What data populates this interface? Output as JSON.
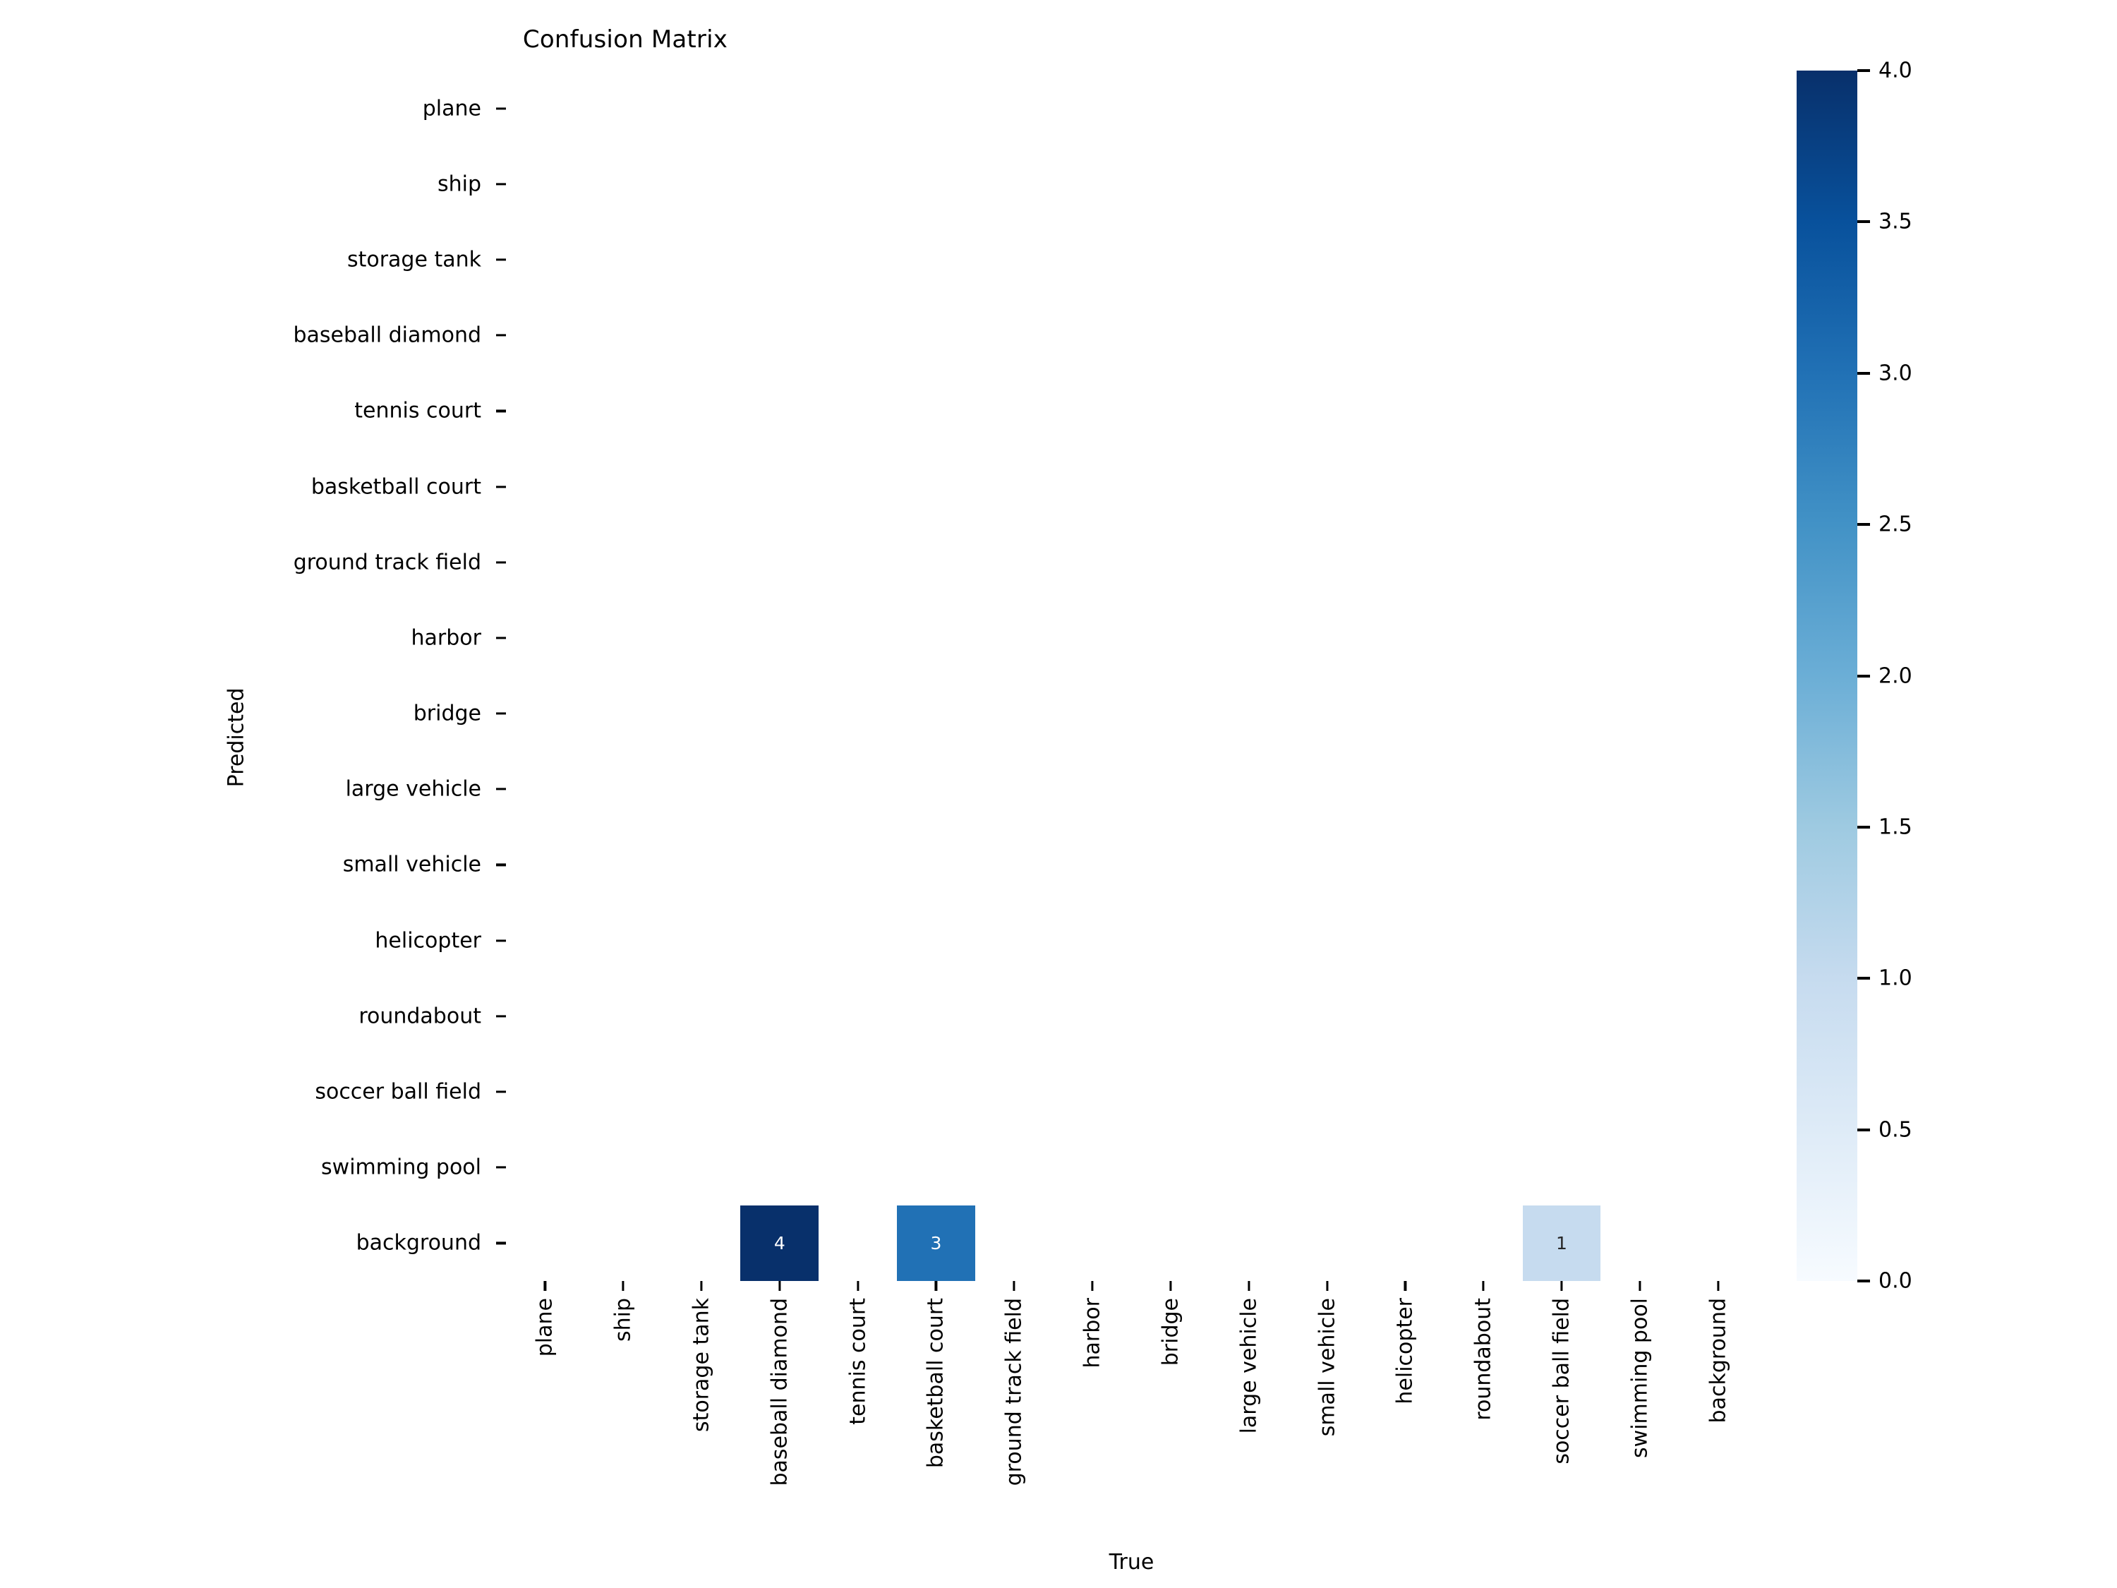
{
  "chart_data": {
    "type": "heatmap",
    "title": "Confusion Matrix",
    "xlabel": "True",
    "ylabel": "Predicted",
    "x_categories": [
      "plane",
      "ship",
      "storage tank",
      "baseball diamond",
      "tennis court",
      "basketball court",
      "ground track field",
      "harbor",
      "bridge",
      "large vehicle",
      "small vehicle",
      "helicopter",
      "roundabout",
      "soccer ball field",
      "swimming pool",
      "background"
    ],
    "y_categories": [
      "plane",
      "ship",
      "storage tank",
      "baseball diamond",
      "tennis court",
      "basketball court",
      "ground track field",
      "harbor",
      "bridge",
      "large vehicle",
      "small vehicle",
      "helicopter",
      "roundabout",
      "soccer ball field",
      "swimming pool",
      "background"
    ],
    "values": [
      [
        0,
        0,
        0,
        0,
        0,
        0,
        0,
        0,
        0,
        0,
        0,
        0,
        0,
        0,
        0,
        0
      ],
      [
        0,
        0,
        0,
        0,
        0,
        0,
        0,
        0,
        0,
        0,
        0,
        0,
        0,
        0,
        0,
        0
      ],
      [
        0,
        0,
        0,
        0,
        0,
        0,
        0,
        0,
        0,
        0,
        0,
        0,
        0,
        0,
        0,
        0
      ],
      [
        0,
        0,
        0,
        0,
        0,
        0,
        0,
        0,
        0,
        0,
        0,
        0,
        0,
        0,
        0,
        0
      ],
      [
        0,
        0,
        0,
        0,
        0,
        0,
        0,
        0,
        0,
        0,
        0,
        0,
        0,
        0,
        0,
        0
      ],
      [
        0,
        0,
        0,
        0,
        0,
        0,
        0,
        0,
        0,
        0,
        0,
        0,
        0,
        0,
        0,
        0
      ],
      [
        0,
        0,
        0,
        0,
        0,
        0,
        0,
        0,
        0,
        0,
        0,
        0,
        0,
        0,
        0,
        0
      ],
      [
        0,
        0,
        0,
        0,
        0,
        0,
        0,
        0,
        0,
        0,
        0,
        0,
        0,
        0,
        0,
        0
      ],
      [
        0,
        0,
        0,
        0,
        0,
        0,
        0,
        0,
        0,
        0,
        0,
        0,
        0,
        0,
        0,
        0
      ],
      [
        0,
        0,
        0,
        0,
        0,
        0,
        0,
        0,
        0,
        0,
        0,
        0,
        0,
        0,
        0,
        0
      ],
      [
        0,
        0,
        0,
        0,
        0,
        0,
        0,
        0,
        0,
        0,
        0,
        0,
        0,
        0,
        0,
        0
      ],
      [
        0,
        0,
        0,
        0,
        0,
        0,
        0,
        0,
        0,
        0,
        0,
        0,
        0,
        0,
        0,
        0
      ],
      [
        0,
        0,
        0,
        0,
        0,
        0,
        0,
        0,
        0,
        0,
        0,
        0,
        0,
        0,
        0,
        0
      ],
      [
        0,
        0,
        0,
        0,
        0,
        0,
        0,
        0,
        0,
        0,
        0,
        0,
        0,
        0,
        0,
        0
      ],
      [
        0,
        0,
        0,
        0,
        0,
        0,
        0,
        0,
        0,
        0,
        0,
        0,
        0,
        0,
        0,
        0
      ],
      [
        0,
        0,
        0,
        4,
        0,
        3,
        0,
        0,
        0,
        0,
        0,
        0,
        0,
        1,
        0,
        0
      ]
    ],
    "annotated_cells": [
      {
        "row": 15,
        "col": 3,
        "row_label": "background",
        "col_label": "baseball diamond",
        "value": 4,
        "fill": "#08306b",
        "text_color": "#ffffff"
      },
      {
        "row": 15,
        "col": 5,
        "row_label": "background",
        "col_label": "basketball court",
        "value": 3,
        "fill": "#2171b5",
        "text_color": "#ffffff"
      },
      {
        "row": 15,
        "col": 13,
        "row_label": "background",
        "col_label": "soccer ball field",
        "value": 1,
        "fill": "#c6dbef",
        "text_color": "#262626"
      }
    ],
    "colormap": "Blues",
    "colorbar": {
      "vmin": 0.0,
      "vmax": 4.0,
      "ticks": [
        "0.0",
        "0.5",
        "1.0",
        "1.5",
        "2.0",
        "2.5",
        "3.0",
        "3.5",
        "4.0"
      ],
      "tick_values": [
        0.0,
        0.5,
        1.0,
        1.5,
        2.0,
        2.5,
        3.0,
        3.5,
        4.0
      ],
      "position": "right",
      "gradient_stops": [
        "#f7fbff",
        "#deebf7",
        "#c6dbef",
        "#9ecae1",
        "#6baed6",
        "#4292c6",
        "#2171b5",
        "#08519c",
        "#08306b"
      ]
    },
    "grid": false,
    "background_color": "#ffffff"
  }
}
